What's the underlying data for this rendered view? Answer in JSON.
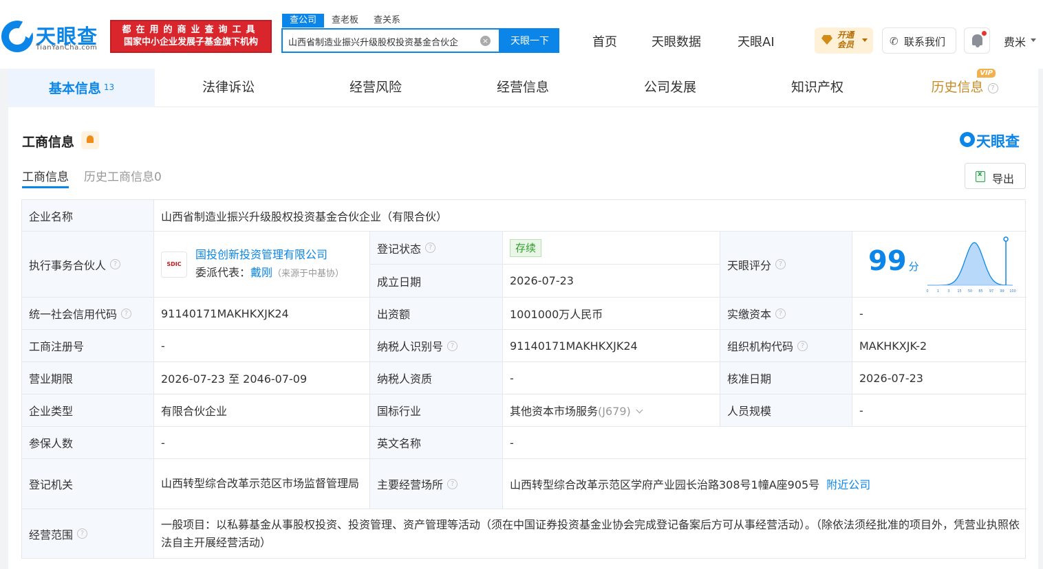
{
  "header": {
    "logo_text": "天眼查",
    "logo_sub": "TianYanCha.com",
    "banner_line1": "都在用的商业查询工具",
    "banner_line2": "国家中小企业发展子基金旗下机构",
    "search_tabs": [
      "查公司",
      "查老板",
      "查关系"
    ],
    "search_value": "山西省制造业振兴升级股权投资基金合伙企",
    "search_button": "天眼一下",
    "nav": [
      "首页",
      "天眼数据",
      "天眼AI"
    ],
    "vip_line1": "开通",
    "vip_line2": "会员",
    "contact": "联系我们",
    "user": "费米"
  },
  "tabs": [
    {
      "label": "基本信息",
      "count": "13"
    },
    {
      "label": "法律诉讼"
    },
    {
      "label": "经营风险"
    },
    {
      "label": "经营信息"
    },
    {
      "label": "公司发展"
    },
    {
      "label": "知识产权"
    },
    {
      "label": "历史信息",
      "badge": "VIP"
    }
  ],
  "section": {
    "title": "工商信息",
    "brand": "天眼查",
    "subtabs": [
      "工商信息",
      "历史工商信息0"
    ],
    "export": "导出"
  },
  "info": {
    "company_name_label": "企业名称",
    "company_name": "山西省制造业振兴升级股权投资基金合伙企业（有限合伙）",
    "partner_label": "执行事务合伙人",
    "partner_logo": "SDIC",
    "partner_name": "国投创新投资管理有限公司",
    "delegate_label": "委派代表：",
    "delegate_name": "戴刚",
    "delegate_source": "（来源于中基协）",
    "reg_status_label": "登记状态",
    "reg_status": "存续",
    "found_date_label": "成立日期",
    "found_date": "2026-07-23",
    "score_label": "天眼评分",
    "score": "99",
    "score_unit": "分",
    "credit_code_label": "统一社会信用代码",
    "credit_code": "91140171MAKHKXJK24",
    "capital_label": "出资额",
    "capital": "1001000万人民币",
    "paid_capital_label": "实缴资本",
    "paid_capital": "-",
    "reg_no_label": "工商注册号",
    "reg_no": "-",
    "tax_id_label": "纳税人识别号",
    "tax_id": "91140171MAKHKXJK24",
    "org_code_label": "组织机构代码",
    "org_code": "MAKHKXJK-2",
    "term_label": "营业期限",
    "term": "2026-07-23 至 2046-07-09",
    "taxpayer_label": "纳税人资质",
    "taxpayer": "-",
    "approval_date_label": "核准日期",
    "approval_date": "2026-07-23",
    "type_label": "企业类型",
    "type": "有限合伙企业",
    "industry_label": "国标行业",
    "industry": "其他资本市场服务",
    "industry_code": "(J679)",
    "staff_label": "人员规模",
    "staff": "-",
    "insured_label": "参保人数",
    "insured": "-",
    "english_label": "英文名称",
    "english": "-",
    "authority_label": "登记机关",
    "authority": "山西转型综合改革示范区市场监督管理局",
    "address_label": "主要经营场所",
    "address": "山西转型综合改革示范区学府产业园长治路308号1幢A座905号",
    "nearby": "附近公司",
    "scope_label": "经营范围",
    "scope": "一般项目：以私募基金从事股权投资、投资管理、资产管理等活动（须在中国证券投资基金业协会完成登记备案后方可从事经营活动）。（除依法须经批准的项目外，凭营业执照依法自主开展经营活动）"
  },
  "score_chart": {
    "ticks": [
      "0",
      "1",
      "3",
      "15",
      "50",
      "85",
      "97",
      "99",
      "100"
    ],
    "marker": 99,
    "accent": "#0b86e8"
  }
}
